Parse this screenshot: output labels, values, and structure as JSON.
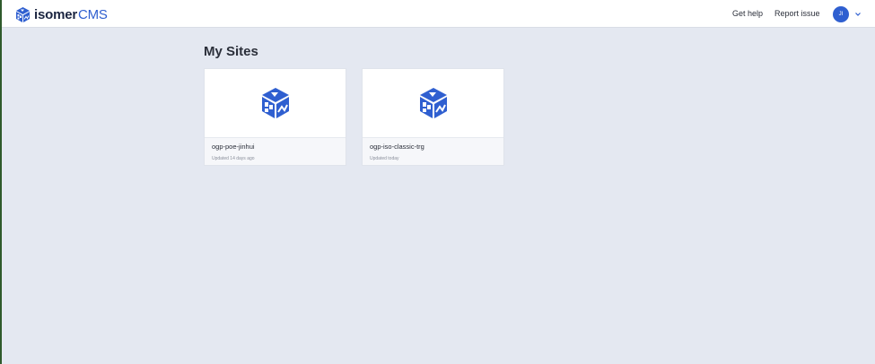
{
  "brand": {
    "name": "isomer",
    "suffix": "CMS",
    "accent_color": "#2f5fd0"
  },
  "header": {
    "get_help_label": "Get help",
    "report_issue_label": "Report issue",
    "avatar_initials": "JI",
    "menu_icon": "chevron-down-icon"
  },
  "main": {
    "title": "My Sites",
    "sites": [
      {
        "name": "ogp-poe-jinhui",
        "updated": "Updated 14 days ago",
        "icon": "isomer-cube-icon"
      },
      {
        "name": "ogp-iso-classic-trg",
        "updated": "Updated today",
        "icon": "isomer-cube-icon"
      }
    ]
  }
}
